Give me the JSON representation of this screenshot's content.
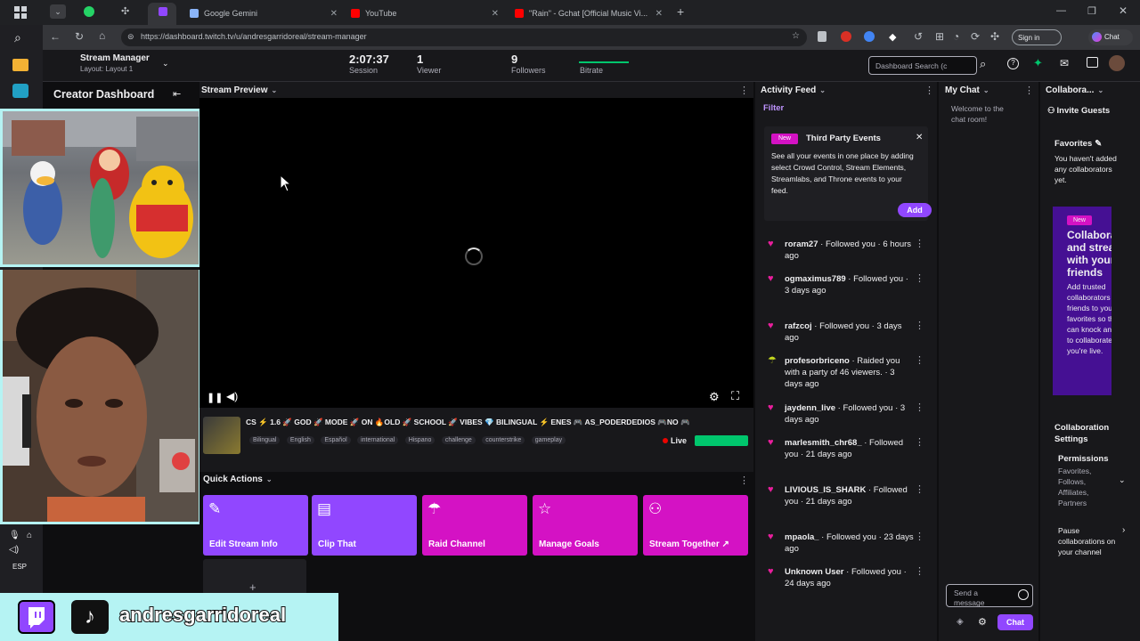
{
  "browser": {
    "tabs": [
      {
        "label": "Google Gemini",
        "color": "#8ab4f8"
      },
      {
        "label": "YouTube",
        "color": "#ff0000"
      },
      {
        "label": "\"Rain\" - Gchat [Official Music Vi...",
        "color": "#ff0000"
      }
    ],
    "new_tab": "+",
    "url": "https://dashboard.twitch.tv/u/andresgarridoreal/stream-manager",
    "sign_in": "Sign in",
    "chat_btn": "Chat"
  },
  "header": {
    "menu_title": "Stream Manager",
    "menu_subtitle": "Layout: Layout 1",
    "session_time": "2:07:37",
    "session_label": "Session",
    "viewers_value": "1",
    "viewers_label": "Viewer",
    "followers_value": "9",
    "followers_label": "Followers",
    "bitrate_label": "Bitrate",
    "search_placeholder": "Dashboard Search (c"
  },
  "sidebar": {
    "title": "Creator Dashboard"
  },
  "preview": {
    "title": "Stream Preview",
    "stream_title": "CS ⚡ 1.6 🚀 GOD 🚀 MODE 🚀 ON 🔥OLD 🚀 SCHOOL 🚀 VIBES 💎 BILINGUAL ⚡ ENES 🎮 AS_PODERDEDIOS 🎮NO 🎮",
    "tags": [
      "Bilingual",
      "English",
      "Español",
      "international",
      "Hispano",
      "challenge",
      "counterstrike",
      "gameplay"
    ],
    "live_label": "Live"
  },
  "quick_actions": {
    "title": "Quick Actions",
    "buttons": [
      {
        "label": "Edit Stream Info",
        "color": "#9147ff",
        "icon": "pencil-icon"
      },
      {
        "label": "Clip That",
        "color": "#9147ff",
        "icon": "clip-icon"
      },
      {
        "label": "Raid Channel",
        "color": "#d412c4",
        "icon": "raid-icon"
      },
      {
        "label": "Manage Goals",
        "color": "#d412c4",
        "icon": "star-icon"
      },
      {
        "label": "Stream Together ↗",
        "color": "#d412c4",
        "icon": "add-person-icon"
      }
    ],
    "add_symbol": "+"
  },
  "activity": {
    "title": "Activity Feed",
    "filter": "Filter",
    "promo_badge": "New",
    "promo_title": "Third Party Events",
    "promo_body": "See all your events in one place by adding select Crowd Control, Stream Elements, Streamlabs, and Throne events to your feed.",
    "promo_add": "Add",
    "items": [
      {
        "name": "roram27",
        "text": " · Followed you · 6 hours ago"
      },
      {
        "name": "ogmaximus789",
        "text": " · Followed you · 3 days ago"
      },
      {
        "name": "rafzcoj",
        "text": " · Followed you · 3 days ago"
      },
      {
        "name": "profesorbricenо",
        "text": " · Raided you with a party of 46 viewers. · 3 days ago"
      },
      {
        "name": "jaydenn_live",
        "text": " · Followed you · 3 days ago"
      },
      {
        "name": "marlesmith_chr68_",
        "text": " · Followed you · 21 days ago"
      },
      {
        "name": "LIVIOUS_IS_SHARK",
        "text": " · Followed you · 21 days ago"
      },
      {
        "name": "mpaola_",
        "text": " · Followed you · 23 days ago"
      },
      {
        "name": "Unknown User",
        "text": " · Followed you · 24 days ago"
      }
    ]
  },
  "chat": {
    "title": "My Chat",
    "welcome": "Welcome to the chat room!",
    "input_placeholder": "Send a message",
    "send": "Chat"
  },
  "collab": {
    "title": "Collabora...",
    "invite": "Invite Guests",
    "favorites_title": "Favorites",
    "favorites_body": "You haven't added any collaborators yet.",
    "card_badge": "New",
    "card_title": "Collaborate and stream with your friends",
    "card_body": "Add trusted collaborators and friends to your favorites so they can knock and ask to collaborate when you're live.",
    "settings_title": "Collaboration Settings",
    "permissions_title": "Permissions",
    "permissions_body": "Favorites, Follows, Affiliates, Partners",
    "pause_body": "Pause collaborations on your channel"
  },
  "overlay": {
    "username": "andresgarridoreal"
  },
  "system": {
    "lang": "ESP"
  }
}
